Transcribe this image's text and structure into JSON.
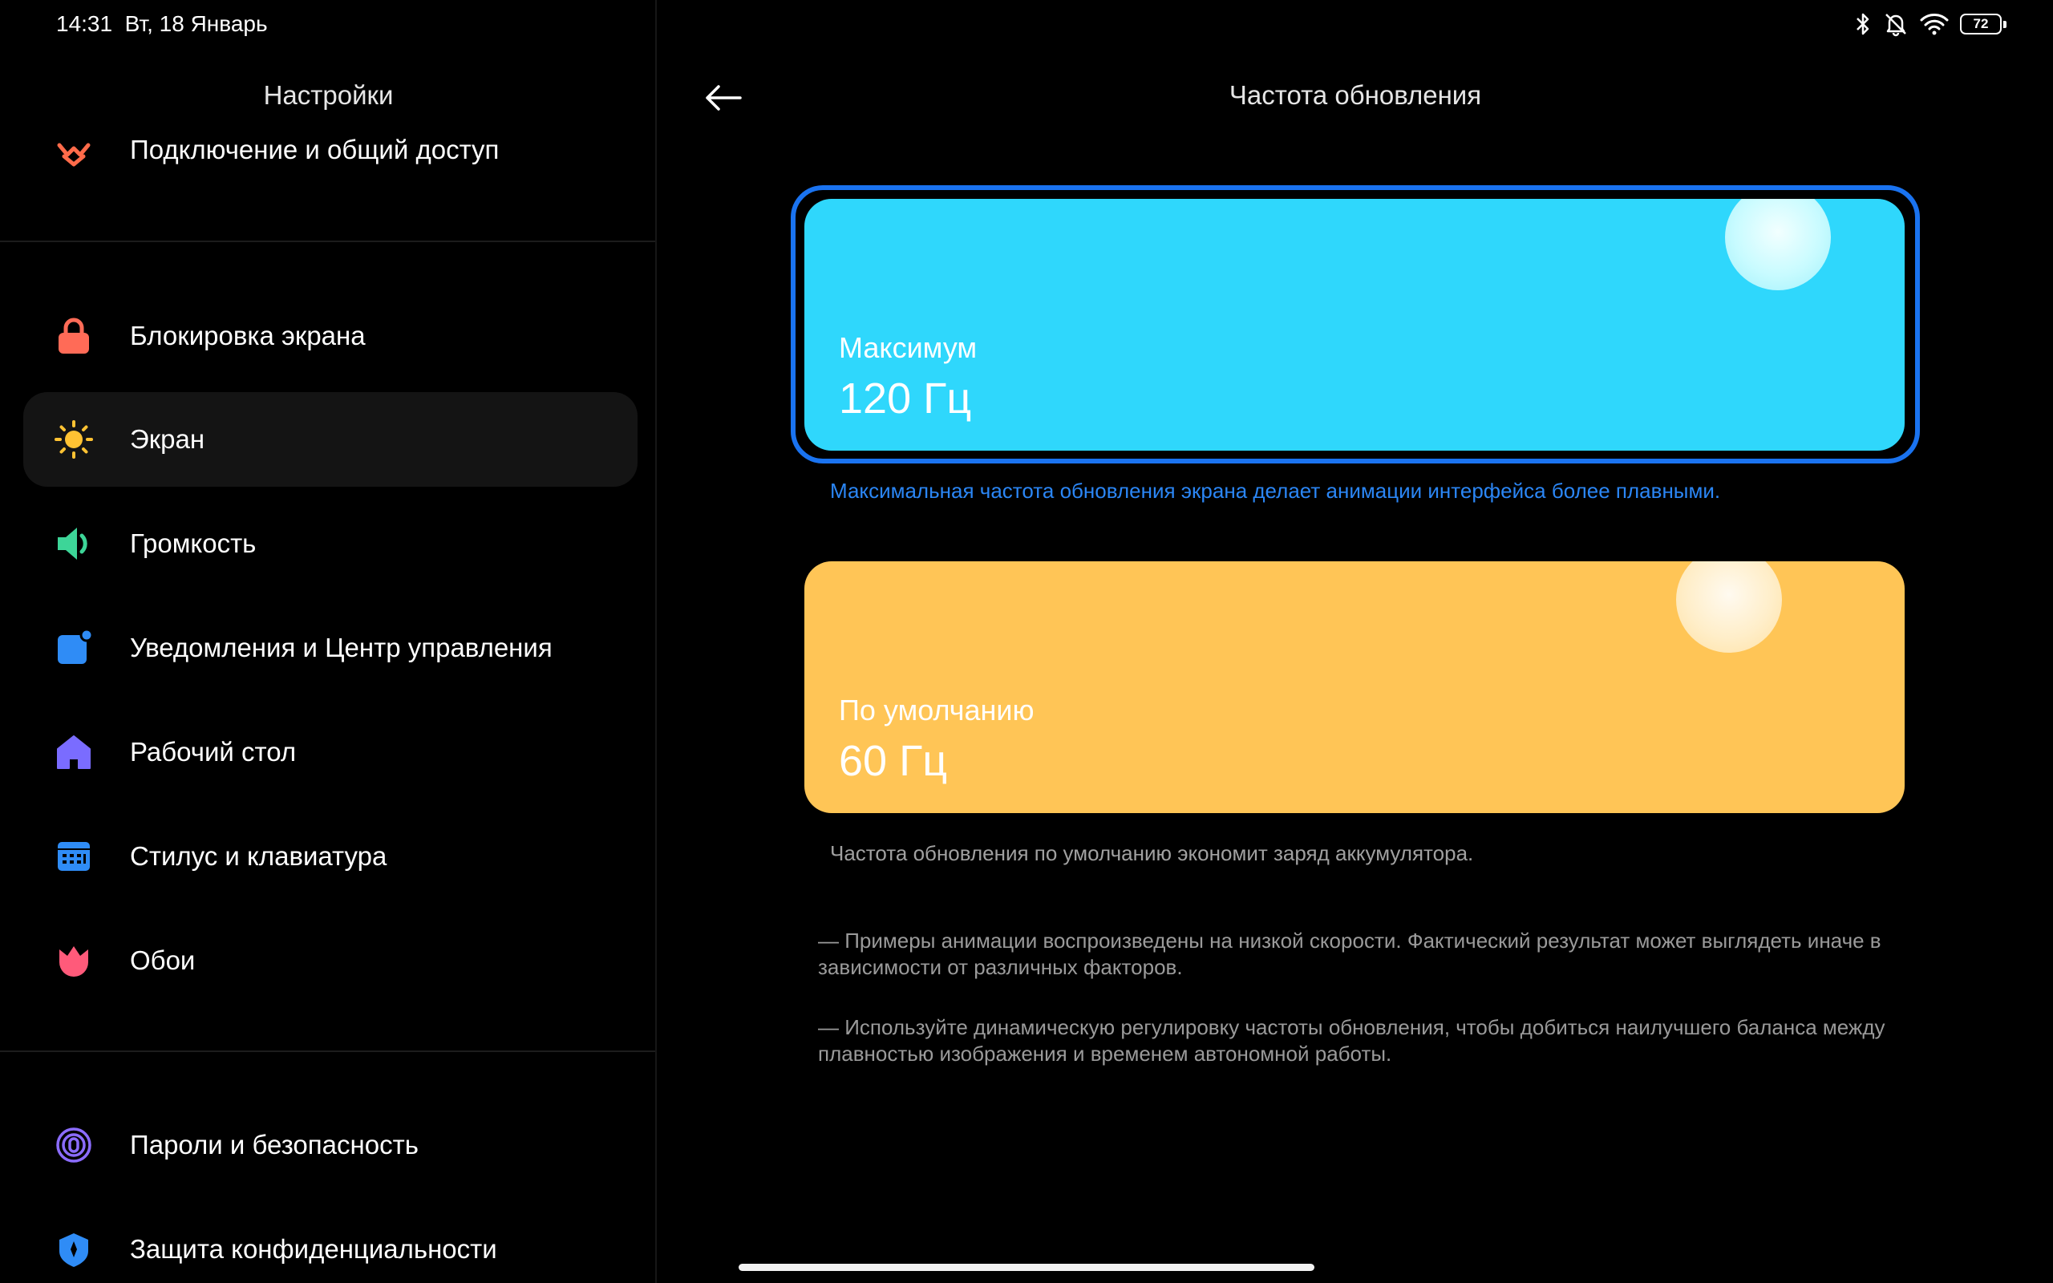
{
  "status_bar": {
    "time": "14:31",
    "date": "Вт, 18 Январь",
    "battery": "72"
  },
  "sidebar": {
    "title": "Настройки",
    "items": [
      {
        "label": "Подключение и общий доступ",
        "icon": "share-icon",
        "color": "#ff6b4a"
      },
      {
        "label": "Блокировка экрана",
        "icon": "lock-icon",
        "color": "#ff6b57"
      },
      {
        "label": "Экран",
        "icon": "sun-icon",
        "color": "#ffc233",
        "selected": true
      },
      {
        "label": "Громкость",
        "icon": "speaker-icon",
        "color": "#3dd598"
      },
      {
        "label": "Уведомления и Центр управления",
        "icon": "notification-icon",
        "color": "#2f8cf6"
      },
      {
        "label": "Рабочий стол",
        "icon": "home-icon",
        "color": "#7a6cff"
      },
      {
        "label": "Стилус и клавиатура",
        "icon": "keyboard-icon",
        "color": "#2f8cf6"
      },
      {
        "label": "Обои",
        "icon": "tulip-icon",
        "color": "#ff5a7a"
      },
      {
        "label": "Пароли и безопасность",
        "icon": "fingerprint-icon",
        "color": "#8b6cff"
      },
      {
        "label": "Защита конфиденциальности",
        "icon": "privacy-icon",
        "color": "#2f8cf6"
      }
    ]
  },
  "main": {
    "title": "Частота обновления",
    "options": [
      {
        "caption": "Максимум",
        "value": "120 Гц",
        "description": "Максимальная частота обновления экрана делает анимации интерфейса более плавными.",
        "color": "#2fd7fc",
        "selected": true
      },
      {
        "caption": "По умолчанию",
        "value": "60 Гц",
        "description": "Частота обновления по умолчанию экономит заряд аккумулятора.",
        "color": "#ffc556",
        "selected": false
      }
    ],
    "notes": [
      "— Примеры анимации воспроизведены на низкой скорости. Фактический результат может выглядеть иначе в зависимости от различных факторов.",
      "— Используйте динамическую регулировку частоты обновления, чтобы добиться наилучшего баланса между плавностью изображения и временем автономной работы."
    ]
  },
  "colors": {
    "accent": "#1a73f0",
    "accent_text": "#2b86f5"
  }
}
